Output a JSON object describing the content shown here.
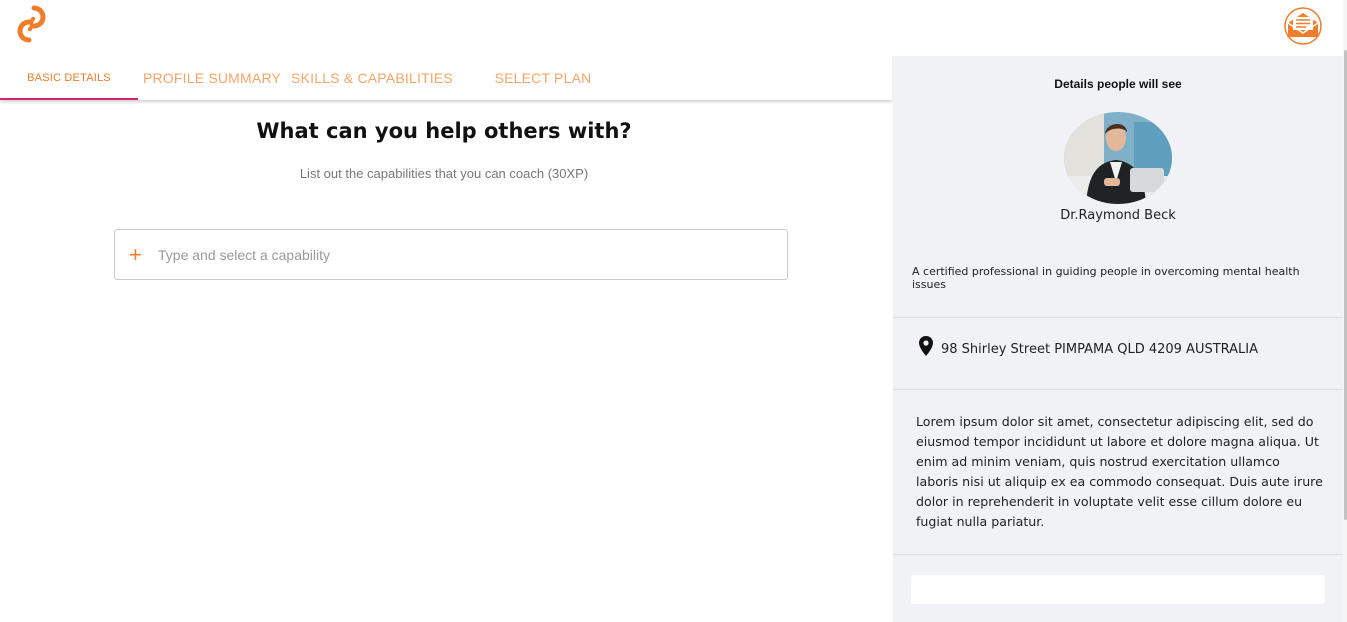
{
  "header": {
    "logo_icon": "link-logo-icon",
    "mail_icon": "envelope-icon",
    "accent_color": "#f07c2c"
  },
  "tabs": [
    {
      "label": "BASIC DETAILS",
      "active": true
    },
    {
      "label": "PROFILE SUMMARY",
      "active": false
    },
    {
      "label": "SKILLS & CAPABILITIES",
      "active": false
    },
    {
      "label": "SELECT PLAN",
      "active": false
    }
  ],
  "main": {
    "title": "What can you help others with?",
    "subtitle": "List out the capabilities that you can coach (30XP)",
    "capability_input": {
      "value": "",
      "placeholder": "Type and select a capability",
      "icon": "plus-icon"
    }
  },
  "preview": {
    "heading": "Details people will see",
    "name": "Dr.Raymond Beck",
    "tagline": "A certified professional in guiding people in overcoming mental health issues",
    "location_icon": "map-pin-icon",
    "location": "98 Shirley Street PIMPAMA QLD 4209 AUSTRALIA",
    "bio": "Lorem ipsum dolor sit amet, consectetur adipiscing elit, sed do eiusmod tempor incididunt ut labore et dolore magna aliqua. Ut enim ad minim veniam, quis nostrud exercitation ullamco laboris nisi ut aliquip ex ea commodo consequat. Duis aute irure dolor in reprehenderit in voluptate velit esse cillum dolore eu fugiat nulla pariatur."
  }
}
